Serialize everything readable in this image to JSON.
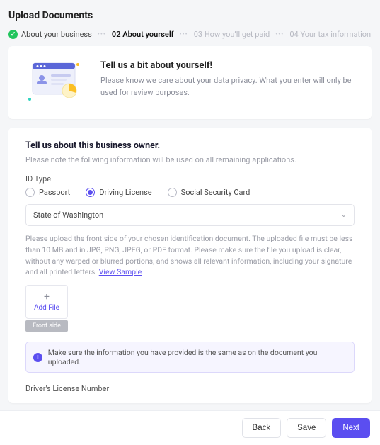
{
  "page": {
    "title": "Upload Documents"
  },
  "stepper": {
    "steps": [
      {
        "label": "About your business",
        "state": "done"
      },
      {
        "label": "02 About yourself",
        "state": "current"
      },
      {
        "label": "03 How you’ll get paid",
        "state": "future"
      },
      {
        "label": "04 Your tax information",
        "state": "future"
      }
    ]
  },
  "hero": {
    "title": "Tell us a bit about yourself!",
    "body": "Please know we care about your data privacy. What you enter will only be used for review purposes."
  },
  "owner_section": {
    "title": "Tell us about this business owner.",
    "subtitle": "Please note the follwing information will be used on all remaining applications."
  },
  "id_type": {
    "label": "ID Type",
    "options": [
      {
        "label": "Passport",
        "selected": false
      },
      {
        "label": "Driving License",
        "selected": true
      },
      {
        "label": "Social Security Card",
        "selected": false
      }
    ],
    "state_select": "State of Washington"
  },
  "upload": {
    "help": "Please upload the front side of your chosen identification document. The uploaded file must be less than 10 MB and in JPG, PNG, JPEG, or PDF format. Please make sure the file you upload is clear, without any warped or blurred portions, and shows all relevant information, including your signature and all printed letters.",
    "link_label": "View Sample",
    "add_label": "Add File",
    "caption": "Front side"
  },
  "notice": {
    "text": "Make sure the information you have provided is the same as on the document you uploaded."
  },
  "dln": {
    "label": "Driver's License Number"
  },
  "footer": {
    "back": "Back",
    "save": "Save",
    "next": "Next"
  }
}
